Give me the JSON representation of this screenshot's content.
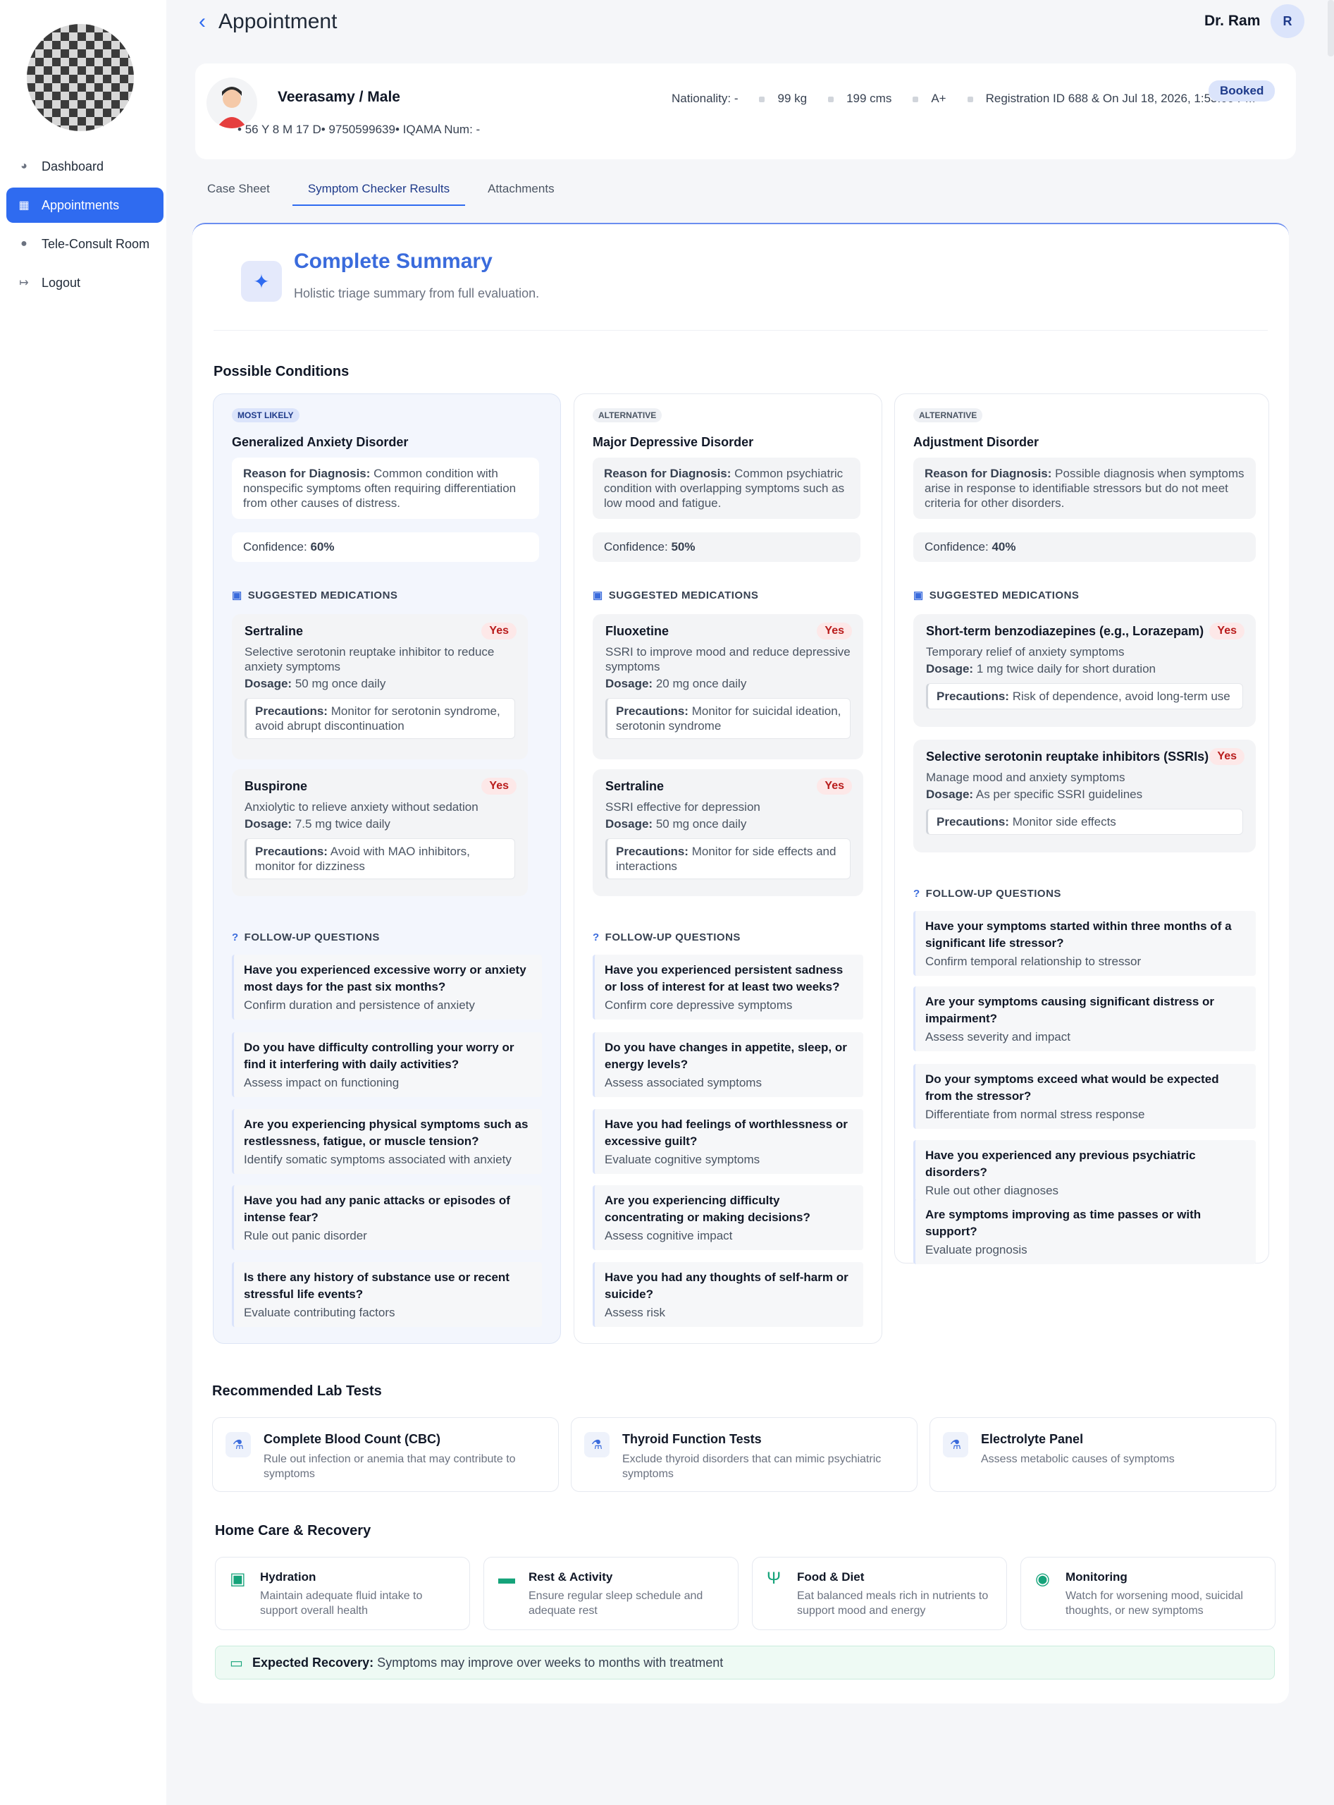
{
  "sidebar": {
    "items": [
      {
        "label": "Dashboard",
        "icon": "pie-chart-icon"
      },
      {
        "label": "Appointments",
        "icon": "calendar-icon"
      },
      {
        "label": "Tele-Consult Room",
        "icon": "user-video-icon"
      },
      {
        "label": "Logout",
        "icon": "logout-icon"
      }
    ]
  },
  "header": {
    "back": "‹",
    "title": "Appointment",
    "doctor": "Dr. Ram",
    "doctor_initial": "R"
  },
  "patient": {
    "name": "Veerasamy / Male",
    "meta": "56 Y 8 M 17 D• 9750599639• IQAMA Num: -",
    "nationality": "Nationality: -",
    "weight": "99 kg",
    "height": "199 cms",
    "blood": "A+",
    "registration": "Registration ID 688 & On Jul 18, 2026, 1:53:00 PM",
    "status": "Booked"
  },
  "tabs": [
    "Case Sheet",
    "Symptom Checker Results",
    "Attachments"
  ],
  "summary": {
    "title": "Complete Summary",
    "subtitle": "Holistic triage summary from full evaluation."
  },
  "labels": {
    "possible_conditions": "Possible Conditions",
    "suggested_meds": "SUGGESTED MEDICATIONS",
    "followup": "FOLLOW-UP QUESTIONS",
    "reason": "Reason for Diagnosis:",
    "confidence": "Confidence:",
    "dosage": "Dosage:",
    "precautions": "Precautions:",
    "lab_tests": "Recommended Lab Tests",
    "home_care": "Home Care & Recovery",
    "expected_recovery": "Expected Recovery:"
  },
  "conditions": [
    {
      "badge": "MOST LIKELY",
      "name": "Generalized Anxiety Disorder",
      "reason": "Common condition with nonspecific symptoms often requiring differentiation from other causes of distress.",
      "confidence": "60%",
      "meds": [
        {
          "name": "Sertraline",
          "flag": "Yes",
          "desc": "Selective serotonin reuptake inhibitor to reduce anxiety symptoms",
          "dosage": "50 mg once daily",
          "precautions": "Monitor for serotonin syndrome, avoid abrupt discontinuation"
        },
        {
          "name": "Buspirone",
          "flag": "Yes",
          "desc": "Anxiolytic to relieve anxiety without sedation",
          "dosage": "7.5 mg twice daily",
          "precautions": "Avoid with MAO inhibitors, monitor for dizziness"
        }
      ],
      "questions": [
        {
          "q": "Have you experienced excessive worry or anxiety most days for the past six months?",
          "s": "Confirm duration and persistence of anxiety"
        },
        {
          "q": "Do you have difficulty controlling your worry or find it interfering with daily activities?",
          "s": "Assess impact on functioning"
        },
        {
          "q": "Are you experiencing physical symptoms such as restlessness, fatigue, or muscle tension?",
          "s": "Identify somatic symptoms associated with anxiety"
        },
        {
          "q": "Have you had any panic attacks or episodes of intense fear?",
          "s": "Rule out panic disorder"
        },
        {
          "q": "Is there any history of substance use or recent stressful life events?",
          "s": "Evaluate contributing factors"
        }
      ]
    },
    {
      "badge": "ALTERNATIVE",
      "name": "Major Depressive Disorder",
      "reason": "Common psychiatric condition with overlapping symptoms such as low mood and fatigue.",
      "confidence": "50%",
      "meds": [
        {
          "name": "Fluoxetine",
          "flag": "Yes",
          "desc": "SSRI to improve mood and reduce depressive symptoms",
          "dosage": "20 mg once daily",
          "precautions": "Monitor for suicidal ideation, serotonin syndrome"
        },
        {
          "name": "Sertraline",
          "flag": "Yes",
          "desc": "SSRI effective for depression",
          "dosage": "50 mg once daily",
          "precautions": "Monitor for side effects and interactions"
        }
      ],
      "questions": [
        {
          "q": "Have you experienced persistent sadness or loss of interest for at least two weeks?",
          "s": "Confirm core depressive symptoms"
        },
        {
          "q": "Do you have changes in appetite, sleep, or energy levels?",
          "s": "Assess associated symptoms"
        },
        {
          "q": "Have you had feelings of worthlessness or excessive guilt?",
          "s": "Evaluate cognitive symptoms"
        },
        {
          "q": "Are you experiencing difficulty concentrating or making decisions?",
          "s": "Assess cognitive impact"
        },
        {
          "q": "Have you had any thoughts of self-harm or suicide?",
          "s": "Assess risk"
        }
      ]
    },
    {
      "badge": "ALTERNATIVE",
      "name": "Adjustment Disorder",
      "reason": "Possible diagnosis when symptoms arise in response to identifiable stressors but do not meet criteria for other disorders.",
      "confidence": "40%",
      "meds": [
        {
          "name": "Short-term benzodiazepines (e.g., Lorazepam)",
          "flag": "Yes",
          "desc": "Temporary relief of anxiety symptoms",
          "dosage": "1 mg twice daily for short duration",
          "precautions": "Risk of dependence, avoid long-term use"
        },
        {
          "name": "Selective serotonin reuptake inhibitors (SSRIs)",
          "flag": "Yes",
          "desc": "Manage mood and anxiety symptoms",
          "dosage": "As per specific SSRI guidelines",
          "precautions": "Monitor side effects"
        }
      ],
      "questions": [
        {
          "q": "Have your symptoms started within three months of a significant life stressor?",
          "s": "Confirm temporal relationship to stressor"
        },
        {
          "q": "Are your symptoms causing significant distress or impairment?",
          "s": "Assess severity and impact"
        },
        {
          "q": "Do your symptoms exceed what would be expected from the stressor?",
          "s": "Differentiate from normal stress response"
        },
        {
          "q": "Have you experienced any previous psychiatric disorders?",
          "s": "Rule out other diagnoses"
        },
        {
          "q": "Are symptoms improving as time passes or with support?",
          "s": "Evaluate prognosis"
        }
      ]
    }
  ],
  "lab_tests": [
    {
      "name": "Complete Blood Count (CBC)",
      "desc": "Rule out infection or anemia that may contribute to symptoms"
    },
    {
      "name": "Thyroid Function Tests",
      "desc": "Exclude thyroid disorders that can mimic psychiatric symptoms"
    },
    {
      "name": "Electrolyte Panel",
      "desc": "Assess metabolic causes of symptoms"
    }
  ],
  "home_care": [
    {
      "name": "Hydration",
      "desc": "Maintain adequate fluid intake to support overall health",
      "icon": "cup-icon"
    },
    {
      "name": "Rest & Activity",
      "desc": "Ensure regular sleep schedule and adequate rest",
      "icon": "bed-icon"
    },
    {
      "name": "Food & Diet",
      "desc": "Eat balanced meals rich in nutrients to support mood and energy",
      "icon": "utensils-icon"
    },
    {
      "name": "Monitoring",
      "desc": "Watch for worsening mood, suicidal thoughts, or new symptoms",
      "icon": "eye-icon"
    }
  ],
  "recovery": "Symptoms may improve over weeks to months with treatment",
  "colors": {
    "accent": "#2f6bf0",
    "danger": "#b91c1c",
    "success": "#15a37a"
  }
}
